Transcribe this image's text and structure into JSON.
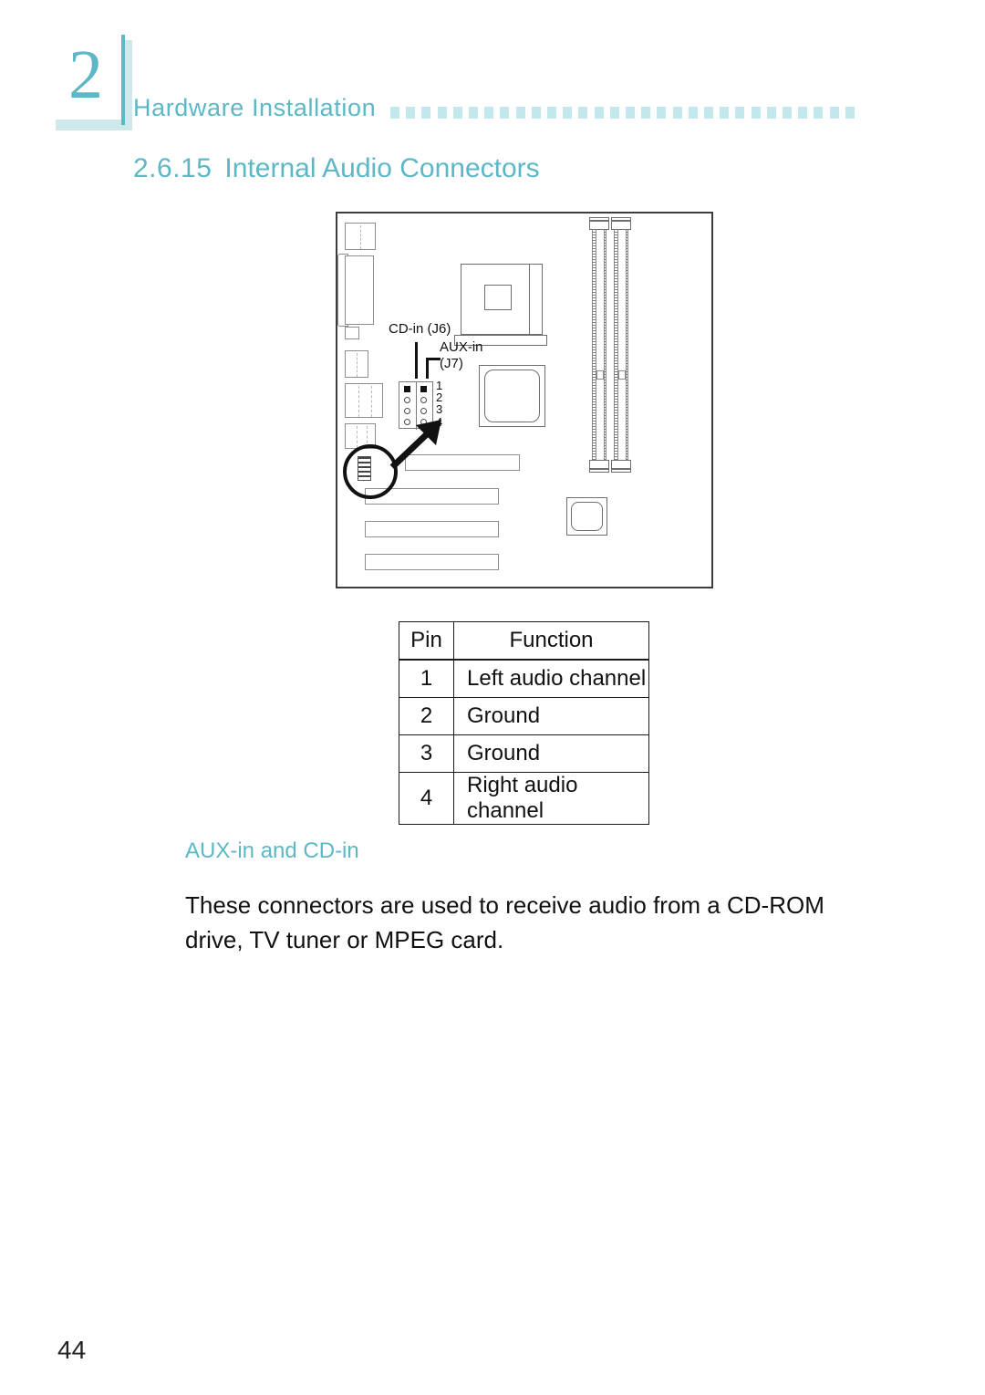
{
  "chapter": {
    "number": "2"
  },
  "header": {
    "title": "Hardware Installation",
    "dot_count": 30
  },
  "section": {
    "number": "2.6.15",
    "title": "Internal Audio Connectors"
  },
  "figure": {
    "labels": {
      "cd_in": "CD-in (J6)",
      "aux_in": "AUX-in",
      "aux_in_ref": "(J7)"
    },
    "pin_numbers": [
      "1",
      "2",
      "3",
      "4"
    ]
  },
  "table": {
    "headers": [
      "Pin",
      "Function"
    ],
    "rows": [
      {
        "pin": "1",
        "function": "Left audio channel"
      },
      {
        "pin": "2",
        "function": "Ground"
      },
      {
        "pin": "3",
        "function": "Ground"
      },
      {
        "pin": "4",
        "function": "Right audio channel"
      }
    ]
  },
  "subsection": {
    "heading": "AUX-in and CD-in",
    "body": "These connectors are used to receive audio from a CD-ROM drive, TV tuner or MPEG card."
  },
  "footer": {
    "page_number": "44"
  },
  "colors": {
    "accent": "#5cb8c4",
    "accent_light": "#c2e7ec",
    "text": "#111111"
  }
}
